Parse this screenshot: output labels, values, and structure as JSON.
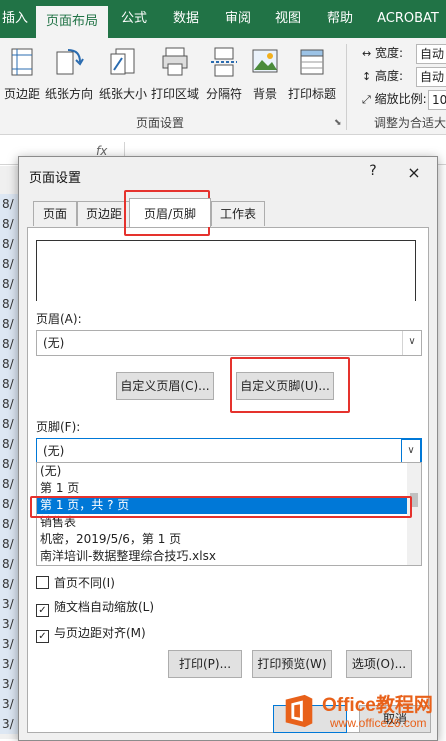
{
  "ribbon": {
    "tabs": [
      "插入",
      "页面布局",
      "公式",
      "数据",
      "审阅",
      "视图",
      "帮助",
      "ACROBAT"
    ],
    "active_tab": "页面布局",
    "buttons": [
      {
        "label": "页边距"
      },
      {
        "label": "纸张方向"
      },
      {
        "label": "纸张大小"
      },
      {
        "label": "打印区域"
      },
      {
        "label": "分隔符"
      },
      {
        "label": "背景"
      },
      {
        "label": "打印标题"
      }
    ],
    "group_page_setup": "页面设置",
    "group_scale": "调整为合适大",
    "width_label": "宽度:",
    "width_value": "自动",
    "height_label": "高度:",
    "height_value": "自动",
    "scale_label": "缩放比例:",
    "scale_value": "10"
  },
  "formula_bar": {
    "fx": "fx"
  },
  "sheet": {
    "row_fragments": [
      "8/",
      "8/",
      "8/",
      "8/",
      "8/",
      "8/",
      "8/",
      "8/",
      "8/",
      "8/",
      "8/",
      "8/",
      "8/",
      "8/",
      "8/",
      "8/",
      "8/",
      "8/",
      "8/",
      "8/",
      "3/",
      "3/",
      "3/",
      "3/",
      "3/",
      "3/",
      "3/"
    ]
  },
  "dialog": {
    "title": "页面设置",
    "help": "?",
    "close": "×",
    "tabs": [
      "页面",
      "页边距",
      "页眉/页脚",
      "工作表"
    ],
    "active_tab": "页眉/页脚",
    "header_label": "页眉(A):",
    "header_value": "(无)",
    "custom_header_button": "自定义页眉(C)...",
    "custom_footer_button": "自定义页脚(U)...",
    "footer_label": "页脚(F):",
    "footer_value": "(无)",
    "footer_options": [
      "(无)",
      "第 1 页",
      "第 1 页，共 ? 页",
      "销售表",
      " 机密，2019/5/6，第 1 页",
      "南洋培训-数据整理综合技巧.xlsx"
    ],
    "selected_option": "第 1 页，共 ? 页",
    "checkboxes": [
      {
        "label": "首页不同(I)",
        "checked": false
      },
      {
        "label": "随文档自动缩放(L)",
        "checked": true
      },
      {
        "label": "与页边距对齐(M)",
        "checked": true
      }
    ],
    "print_button": "打印(P)...",
    "print_preview_button": "打印预览(W)",
    "options_button": "选项(O)...",
    "cancel_button": "取消"
  },
  "watermark": {
    "brand": "Office教程网",
    "url": "www.office26.com"
  },
  "colors": {
    "excel_green": "#217346",
    "selection_blue": "#0078d7",
    "highlight_red": "#e5322d",
    "watermark_orange": "#e8611a"
  }
}
